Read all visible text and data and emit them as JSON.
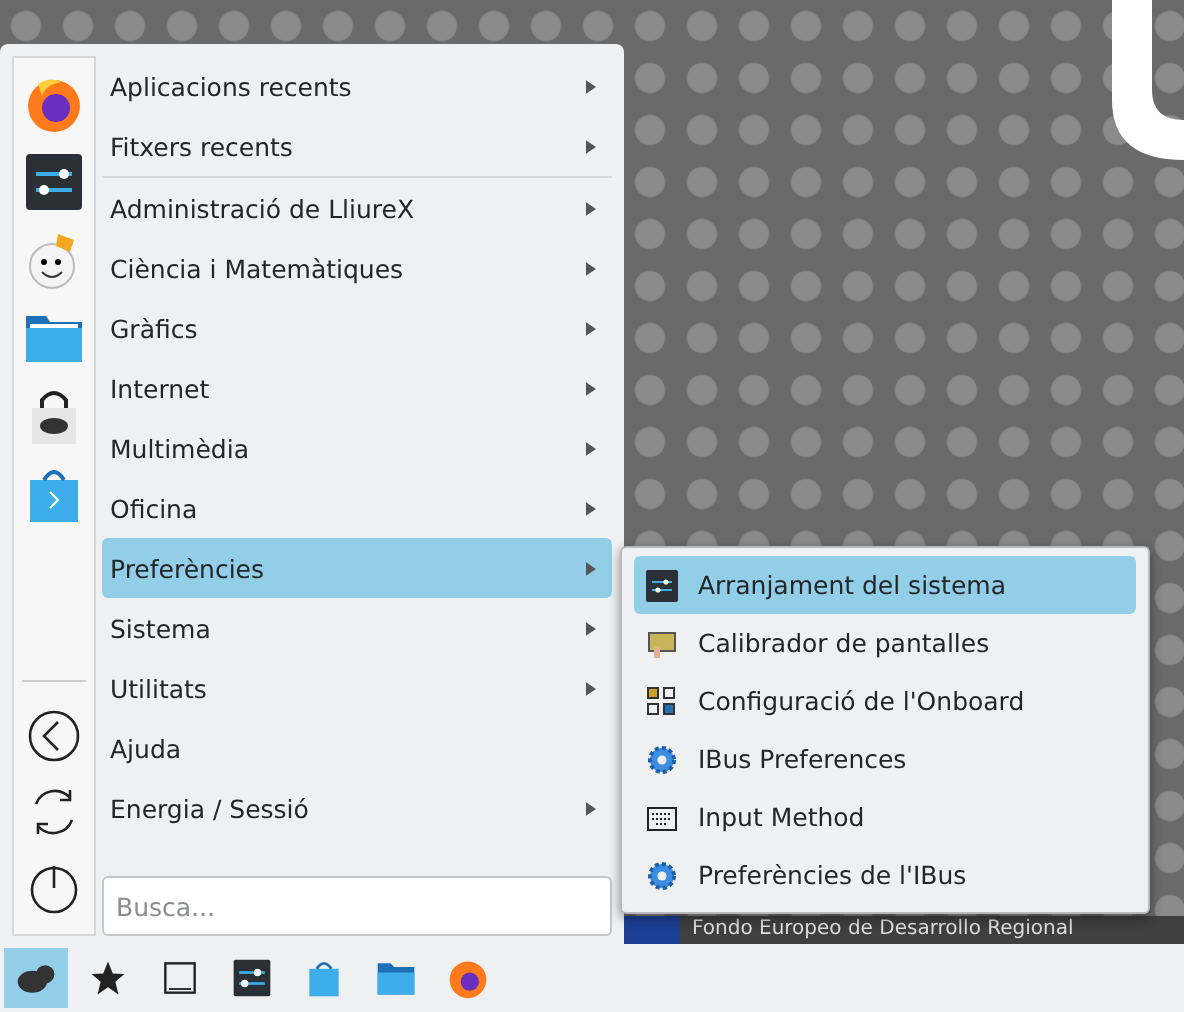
{
  "menu": {
    "items": [
      {
        "label": "Aplicacions recents",
        "has_submenu": true,
        "selected": false
      },
      {
        "label": "Fitxers recents",
        "has_submenu": true,
        "selected": false
      },
      {
        "label": "Administració de LliureX",
        "has_submenu": true,
        "selected": false
      },
      {
        "label": "Ciència i Matemàtiques",
        "has_submenu": true,
        "selected": false
      },
      {
        "label": "Gràfics",
        "has_submenu": true,
        "selected": false
      },
      {
        "label": "Internet",
        "has_submenu": true,
        "selected": false
      },
      {
        "label": "Multimèdia",
        "has_submenu": true,
        "selected": false
      },
      {
        "label": "Oficina",
        "has_submenu": true,
        "selected": false
      },
      {
        "label": "Preferències",
        "has_submenu": true,
        "selected": true
      },
      {
        "label": "Sistema",
        "has_submenu": true,
        "selected": false
      },
      {
        "label": "Utilitats",
        "has_submenu": true,
        "selected": false
      },
      {
        "label": "Ajuda",
        "has_submenu": false,
        "selected": false
      },
      {
        "label": "Energia / Sessió",
        "has_submenu": true,
        "selected": false
      }
    ],
    "search": {
      "placeholder": "Busca..."
    }
  },
  "submenu": {
    "items": [
      {
        "label": "Arranjament del sistema",
        "selected": true
      },
      {
        "label": "Calibrador de pantalles",
        "selected": false
      },
      {
        "label": "Configuració de l'Onboard",
        "selected": false
      },
      {
        "label": "IBus Preferences",
        "selected": false
      },
      {
        "label": "Input Method",
        "selected": false
      },
      {
        "label": "Preferències de l'IBus",
        "selected": false
      }
    ]
  },
  "wallpaper": {
    "banner": "Fondo Europeo de Desarrollo Regional"
  },
  "taskbar": {
    "items": [
      {
        "selected": true
      },
      {
        "selected": false
      },
      {
        "selected": false
      },
      {
        "selected": false
      },
      {
        "selected": false
      },
      {
        "selected": false
      },
      {
        "selected": false
      }
    ]
  }
}
